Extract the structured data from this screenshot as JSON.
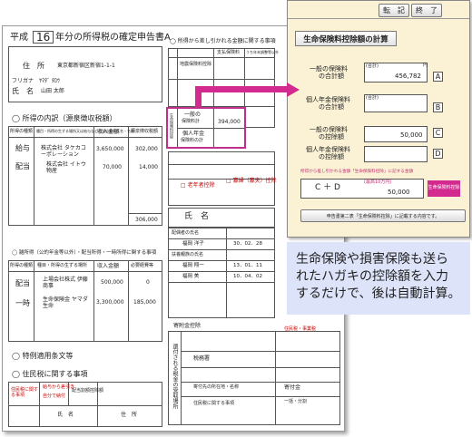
{
  "form": {
    "era": "平成",
    "year": "16",
    "title_rest": "年分の所得税の確定申告書A",
    "address_label": "住　所",
    "address_value": "東京都新宿区新宿1-1-1",
    "furigana_label": "フリガナ",
    "furigana_value": "ﾔﾏﾀﾞ ﾀﾛｳ",
    "name_label": "氏　名",
    "name_value": "山田 太郎",
    "income_section": "所得の内訳（源泉徴収税額）",
    "income_headers": [
      "所得の種類",
      "種目・所得の生ずる場所又は給与などの支払者の氏名・名称",
      "収入金額",
      "源泉徴収税額"
    ],
    "income_rows": [
      {
        "type": "給与",
        "payer": "株式会社 タケカコーポレーション",
        "amount": "3,650,000",
        "tax": "302,000"
      },
      {
        "type": "配当",
        "payer": "株式会社 イトウ物産",
        "amount": "70,000",
        "tax": "14,000"
      }
    ],
    "income_total": "306,000",
    "deduct_header": "所得から差し引かれる金額に関する事項",
    "insurance_rows": [
      "生命保険料控除",
      "地震保険料控除"
    ],
    "ins_sub1_a": "一般の",
    "ins_sub1_b": "保険料計",
    "ins_sub1_val": "394,000",
    "ins_sub2_a": "個人年金",
    "ins_sub2_b": "保険料の計",
    "deduct_cols": [
      "支払保険料",
      "うち年末調整等以外"
    ],
    "pension_label": "老年者控除",
    "widow_labels": [
      "寡婦（寡夫）控除"
    ],
    "dependents_header": "配偶者の氏名",
    "dependents_name_label": "氏　名",
    "dependents": [
      {
        "name": "福岡 洋子",
        "date": "30．02．28"
      },
      {
        "name": "福岡 翔一",
        "date": "13．01．11"
      },
      {
        "name": "福岡 美",
        "date": "10．04．02"
      }
    ],
    "dependents_sub": "扶養親族の氏名",
    "special_header": "雑所得（公的年金等以外）・配当所得・一時所得に関する事項",
    "special_cols": [
      "所得の種類",
      "種目・所得の生ずる場所",
      "収入金額",
      "必要経費等"
    ],
    "special_rows": [
      {
        "type": "配当",
        "place": "上場会社株式 伊藤商事",
        "amount": "500,000",
        "cost": "0"
      },
      {
        "type": "一時",
        "place": "生命保険金 ヤマダ生命",
        "amount": "3,300,000",
        "cost": "185,000"
      }
    ],
    "resident_header": "住民税に関する事項",
    "bottom_header": "特例適用条文等",
    "reg_left": "住民税に関する事項",
    "reg_name_cols": [
      "氏　名",
      "住　所"
    ],
    "relation_rows": [
      "給与から差引き",
      "自分で納付",
      "配当割額控除額"
    ],
    "donation_labels": [
      "寄附金控除",
      "寄付先の所在地・名称",
      "寄付金"
    ],
    "right_bottom_label": "住民税・事業税",
    "bank_header": "還付される税金の受取場所",
    "taxoffice_label": "税務署",
    "final_label": "住民税に関する事項",
    "bottom_right": "一括・分割"
  },
  "calc": {
    "btn_transfer": "転　記",
    "btn_finish": "終　了",
    "title": "生命保険料控除額の計算",
    "a_label_1": "一般の保険料",
    "a_label_2": "の合計額",
    "a_unit": "(合計)",
    "a_yen": "円",
    "a_value": "456,782",
    "a_tag": "A",
    "b_label_1": "個人年金保険料",
    "b_label_2": "の合計額",
    "b_unit": "(合計)",
    "b_tag": "B",
    "c_label_1": "一般の保険料",
    "c_label_2": "の控除額",
    "c_value": "50,000",
    "c_tag": "C",
    "d_label_1": "個人年金保険料",
    "d_label_2": "の控除額",
    "d_tag": "D",
    "note": "所得から差し引かれる金額「生命保険料控除」に記する金額",
    "sum_expr": "C ＋ D",
    "sum_unit": "(最高10万円)",
    "sum_value": "50,000",
    "sum_badge": "生命保険料控除",
    "transfer_button": "申告書第二表「生命保険料控除」に記載する内容です。"
  },
  "callout": {
    "line1": "生命保険や損害保険も送ら",
    "line2": "れたハガキの控除額を入力",
    "line3": "するだけで、後は自動計算。"
  },
  "colors": {
    "accent_magenta": "#d22a8e",
    "callout_bg": "#dde3f8",
    "window_bg": "#fbf2d6"
  }
}
